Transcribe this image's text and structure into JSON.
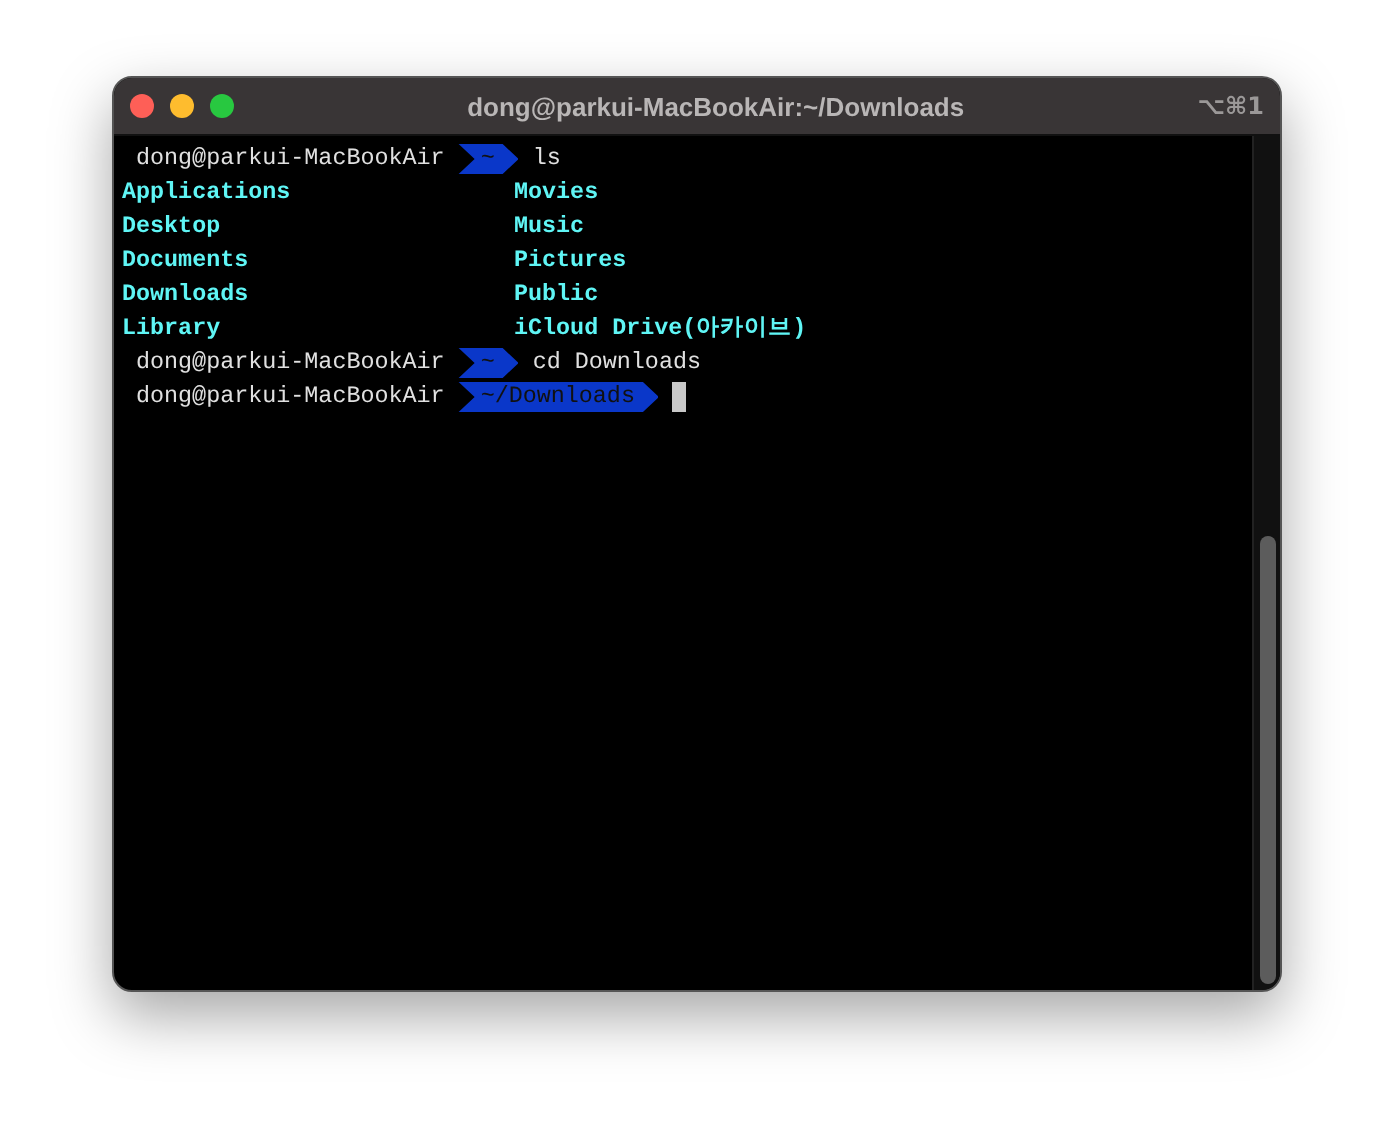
{
  "window": {
    "title": "dong@parkui-MacBookAir:~/Downloads",
    "shortcut": "⌥⌘1"
  },
  "lines": [
    {
      "kind": "prompt",
      "user": "dong@parkui-MacBookAir",
      "path": "~",
      "command": "ls",
      "cursor": false
    },
    {
      "kind": "listing",
      "left": "Applications",
      "right": "Movies"
    },
    {
      "kind": "listing",
      "left": "Desktop",
      "right": "Music"
    },
    {
      "kind": "listing",
      "left": "Documents",
      "right": "Pictures"
    },
    {
      "kind": "listing",
      "left": "Downloads",
      "right": "Public"
    },
    {
      "kind": "listing",
      "left": "Library",
      "right": "iCloud Drive(아카이브)"
    },
    {
      "kind": "prompt",
      "user": "dong@parkui-MacBookAir",
      "path": "~",
      "command": "cd Downloads",
      "cursor": false
    },
    {
      "kind": "prompt",
      "user": "dong@parkui-MacBookAir",
      "path": "~/Downloads",
      "cursor": true
    }
  ]
}
